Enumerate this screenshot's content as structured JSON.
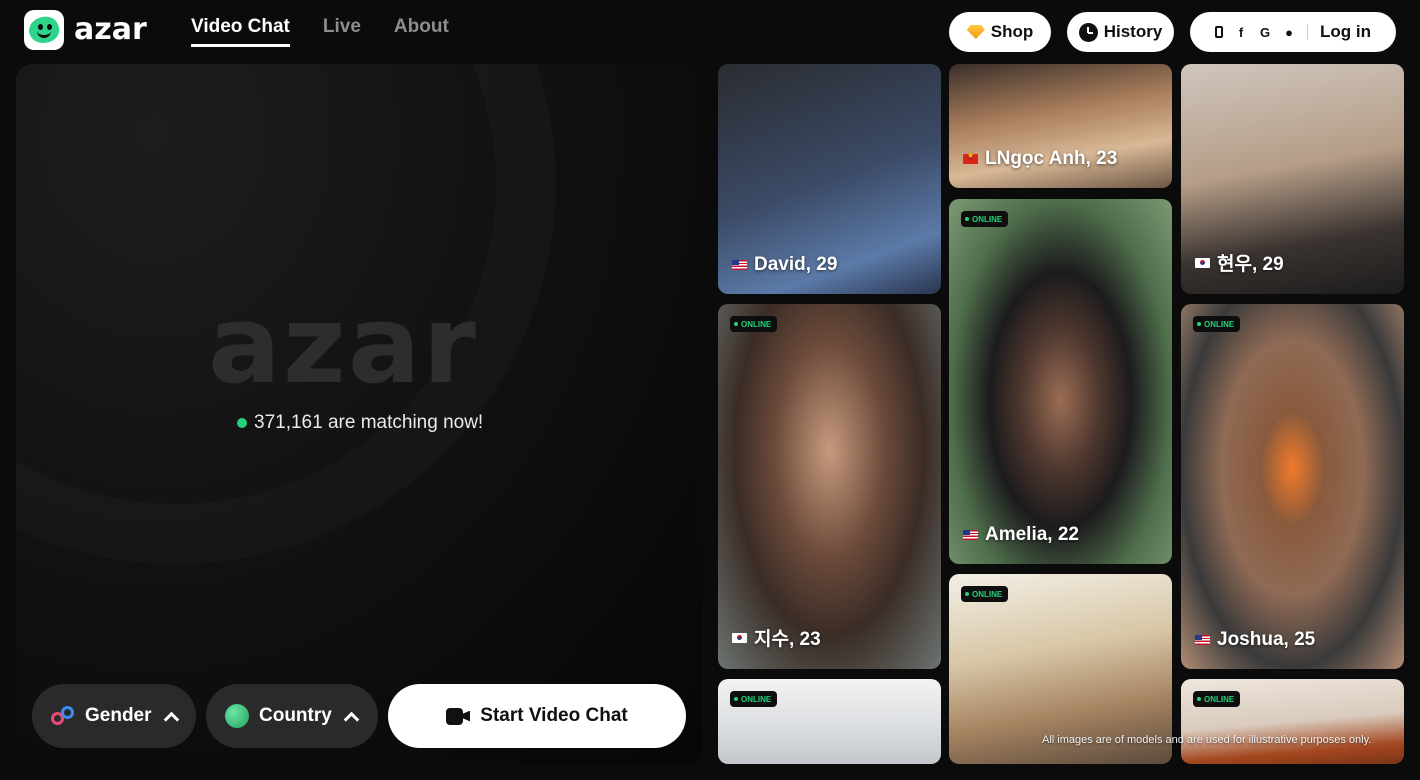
{
  "brand": {
    "name": "azar"
  },
  "nav": [
    {
      "label": "Video Chat",
      "active": true
    },
    {
      "label": "Live",
      "active": false
    },
    {
      "label": "About",
      "active": false
    }
  ],
  "header_actions": {
    "shop_label": "Shop",
    "history_label": "History",
    "login_label": "Log in",
    "login_methods": [
      "phone-icon",
      "facebook-icon",
      "google-icon",
      "apple-icon"
    ]
  },
  "stage": {
    "logo_text": "azar",
    "matching_text": "371,161 are matching now!"
  },
  "controls": {
    "gender_label": "Gender",
    "country_label": "Country",
    "start_label": "Start Video Chat"
  },
  "profiles": [
    {
      "name": "David, 29",
      "flag": "us",
      "online": false
    },
    {
      "name": "LNgọc Anh, 23",
      "flag": "vn",
      "online": false
    },
    {
      "name": "현우, 29",
      "flag": "kr",
      "online": false
    },
    {
      "name": "지수, 23",
      "flag": "kr",
      "online": true
    },
    {
      "name": "Amelia, 22",
      "flag": "us",
      "online": true
    },
    {
      "name": "Joshua, 25",
      "flag": "us",
      "online": true
    },
    {
      "name": "",
      "online": true
    },
    {
      "name": "",
      "online": true
    },
    {
      "name": "",
      "online": true
    }
  ],
  "online_badge": "ONLINE",
  "disclaimer": "All images are of models and are used for illustrative purposes only.",
  "colors": {
    "online_green": "#27d07a",
    "background": "#0b0b0b",
    "accent_white": "#ffffff"
  }
}
